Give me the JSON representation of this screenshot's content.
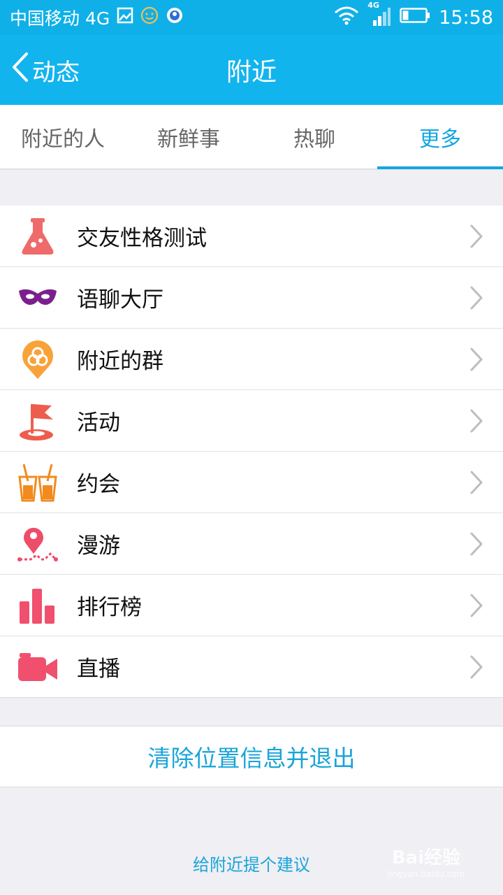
{
  "status_bar": {
    "carrier": "中国移动 4G",
    "network_badge": "4G",
    "time": "15:58"
  },
  "nav": {
    "back_label": "动态",
    "title": "附近"
  },
  "tabs": [
    {
      "label": "附近的人",
      "active": false
    },
    {
      "label": "新鲜事",
      "active": false
    },
    {
      "label": "热聊",
      "active": false
    },
    {
      "label": "更多",
      "active": true
    }
  ],
  "list": {
    "items": [
      {
        "label": "交友性格测试",
        "icon": "flask-icon"
      },
      {
        "label": "语聊大厅",
        "icon": "mask-icon"
      },
      {
        "label": "附近的群",
        "icon": "group-pin-icon"
      },
      {
        "label": "活动",
        "icon": "flag-icon"
      },
      {
        "label": "约会",
        "icon": "drinks-icon"
      },
      {
        "label": "漫游",
        "icon": "roam-pin-icon"
      },
      {
        "label": "排行榜",
        "icon": "bar-chart-icon"
      },
      {
        "label": "直播",
        "icon": "video-camera-icon"
      }
    ]
  },
  "actions": {
    "clear_location": "清除位置信息并退出",
    "suggestion": "给附近提个建议"
  },
  "watermark": {
    "brand": "Bai经验",
    "url": "jingyan.baidu.com"
  },
  "colors": {
    "header": "#12b4ee",
    "accent": "#12a6e0",
    "link": "#1aa4d8"
  }
}
